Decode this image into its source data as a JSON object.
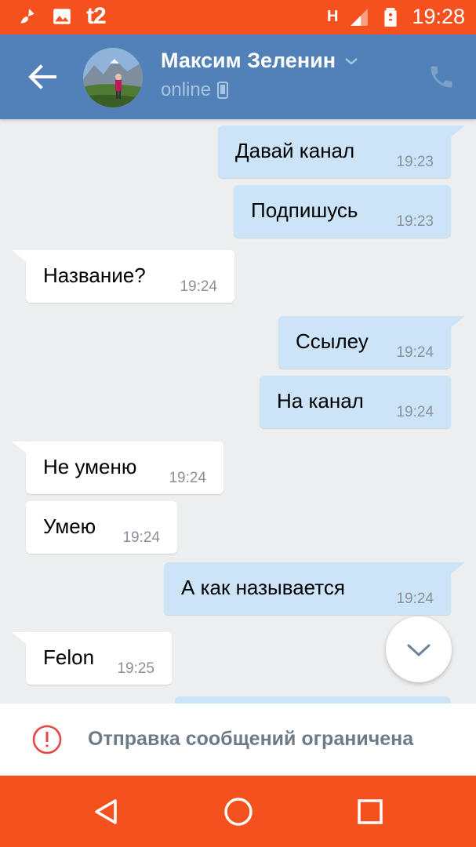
{
  "status_bar": {
    "carrier": "t2",
    "network": "H",
    "time": "19:28",
    "icons": [
      "cleaner-icon",
      "gallery-icon",
      "signal-icon",
      "battery-charging-icon"
    ]
  },
  "header": {
    "contact_name": "Максим Зеленин",
    "status": "online",
    "back_icon": "back-arrow-icon",
    "call_icon": "phone-icon",
    "status_icon": "mobile-device-icon"
  },
  "messages": [
    {
      "dir": "out",
      "text": "Давай канал",
      "time": "19:23"
    },
    {
      "dir": "out",
      "text": "Подпишусь",
      "time": "19:23"
    },
    {
      "dir": "in",
      "text": "Название?",
      "time": "19:24"
    },
    {
      "dir": "out",
      "text": "Ссылеу",
      "time": "19:24"
    },
    {
      "dir": "out",
      "text": "На канал",
      "time": "19:24"
    },
    {
      "dir": "in",
      "text": "Не уменю",
      "time": "19:24"
    },
    {
      "dir": "in",
      "text": "Умею",
      "time": "19:24"
    },
    {
      "dir": "out",
      "text": "А как называется",
      "time": "19:24"
    },
    {
      "dir": "in",
      "text": "Felon",
      "time": "19:25"
    }
  ],
  "restriction": {
    "text": "Отправка сообщений ограничена",
    "icon": "warning-circle-icon"
  },
  "colors": {
    "status_bar": "#f4511e",
    "header": "#5181b8",
    "incoming_bubble": "#ffffff",
    "outgoing_bubble": "#cce4f7",
    "chat_background": "#edeef0",
    "warning": "#e64646"
  }
}
